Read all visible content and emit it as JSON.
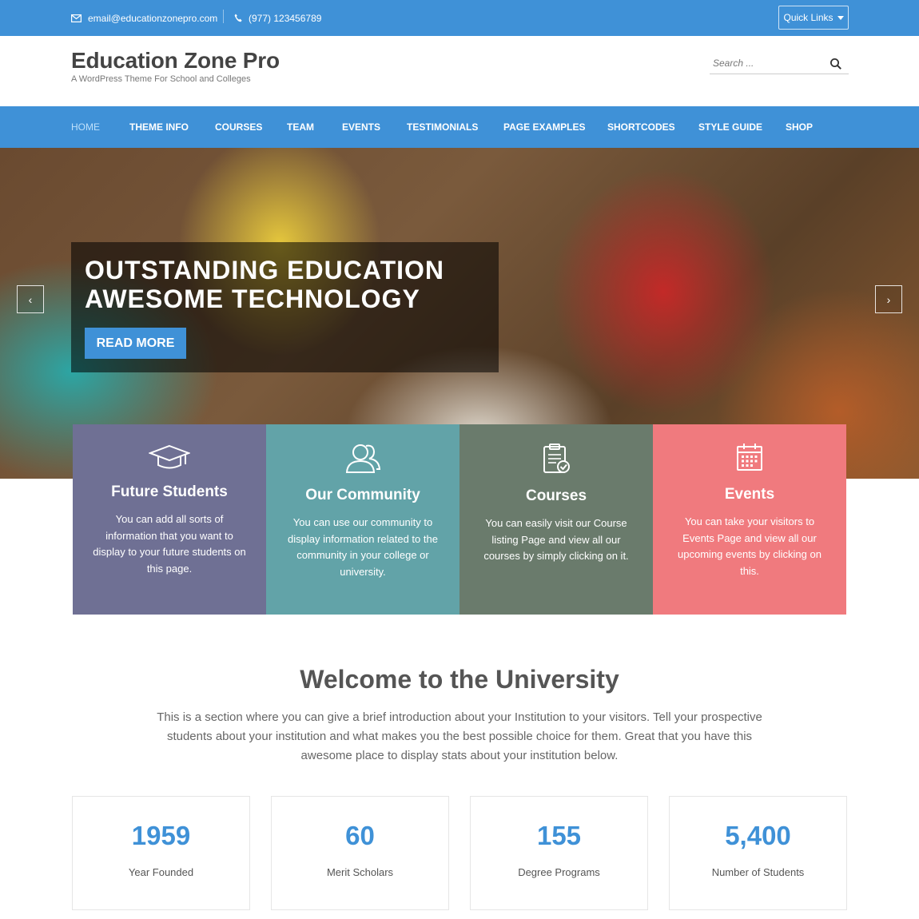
{
  "topbar": {
    "email": "email@educationzonepro.com",
    "phone": "(977) 123456789",
    "quick_links_label": "Quick Links"
  },
  "header": {
    "title": "Education Zone Pro",
    "tagline": "A WordPress Theme For School and Colleges",
    "search_placeholder": "Search ..."
  },
  "nav": {
    "items": [
      "HOME",
      "THEME INFO",
      "COURSES",
      "TEAM",
      "EVENTS",
      "TESTIMONIALS",
      "PAGE EXAMPLES",
      "SHORTCODES",
      "STYLE GUIDE",
      "SHOP"
    ],
    "active": "HOME"
  },
  "hero": {
    "title_line1": "OUTSTANDING EDUCATION",
    "title_line2": "AWESOME TECHNOLOGY",
    "button_label": "READ MORE",
    "prev_symbol": "‹",
    "next_symbol": "›"
  },
  "features": [
    {
      "icon": "graduation-cap-icon",
      "title": "Future Students",
      "text": "You can add all sorts of information that you want to display to your future students on this page.",
      "color": "#6f7094"
    },
    {
      "icon": "community-icon",
      "title": "Our Community",
      "text": "You can use our community to display information related to the community in your college or university.",
      "color": "#62a3a8"
    },
    {
      "icon": "clipboard-check-icon",
      "title": "Courses",
      "text": "You can easily visit our Course listing Page and view all our courses by simply clicking on it.",
      "color": "#6a7b6c"
    },
    {
      "icon": "calendar-icon",
      "title": "Events",
      "text": "You can take your visitors to Events Page and view all our upcoming events by clicking on this.",
      "color": "#f07a7e"
    }
  ],
  "welcome": {
    "title": "Welcome to the University",
    "text": "This is a section where you can give a brief introduction about your Institution to your visitors. Tell your prospective students about your institution and what makes you the best possible choice for them. Great that you have this awesome place to display stats about your institution below."
  },
  "stats": [
    {
      "value": "1959",
      "label": "Year Founded"
    },
    {
      "value": "60",
      "label": "Merit Scholars"
    },
    {
      "value": "155",
      "label": "Degree Programs"
    },
    {
      "value": "5,400",
      "label": "Number of Students"
    }
  ],
  "colors": {
    "brand_blue": "#3f91d7"
  }
}
